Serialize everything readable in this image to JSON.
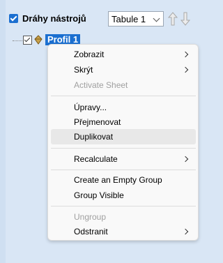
{
  "header": {
    "title": "Dráhy nástrojů",
    "select_value": "Tabule 1"
  },
  "tree": {
    "profile_label": "Profil 1"
  },
  "context_menu": {
    "items": [
      {
        "label": "Zobrazit"
      },
      {
        "label": "Skrýt"
      },
      {
        "label": "Activate Sheet"
      },
      {
        "label": "Úpravy..."
      },
      {
        "label": "Přejmenovat"
      },
      {
        "label": "Duplikovat"
      },
      {
        "label": "Recalculate"
      },
      {
        "label": "Create an Empty Group"
      },
      {
        "label": "Group Visible"
      },
      {
        "label": "Ungroup"
      },
      {
        "label": "Odstranit"
      }
    ]
  },
  "colors": {
    "panel_bg": "#d9e6f5",
    "selection_blue": "#1b6fd0",
    "menu_bg": "#f9f9f9",
    "disabled_text": "#a0a0a0"
  }
}
